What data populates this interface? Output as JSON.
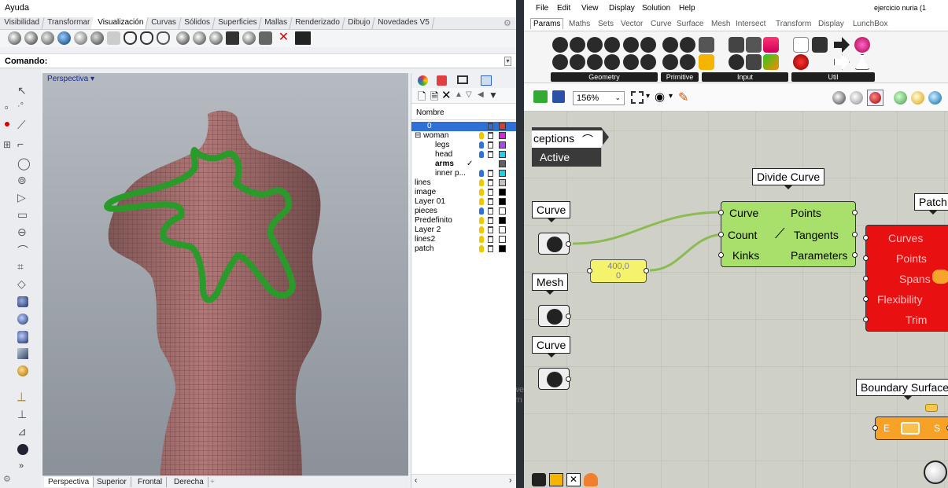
{
  "rhino": {
    "menu_title": "Ayuda",
    "tabs": [
      "Visibilidad",
      "Transformar",
      "Visualización",
      "Curvas",
      "Sólidos",
      "Superficies",
      "Mallas",
      "Renderizado",
      "Dibujo",
      "Novedades V5"
    ],
    "active_tab": "Visualización",
    "command_label": "Comando:",
    "viewport_title": "Perspectiva",
    "viewport_tabs": [
      "Perspectiva",
      "Superior",
      "Frontal",
      "Derecha"
    ],
    "layers_header": "Nombre",
    "layers": [
      {
        "name": "0",
        "color": "#d93a3a",
        "selected": true
      },
      {
        "name": "woman",
        "color": "#e020e0",
        "expander": "⊟"
      },
      {
        "name": "legs",
        "color": "#b040ff"
      },
      {
        "name": "head",
        "color": "#20d0f0"
      },
      {
        "name": "arms",
        "color": "#606060",
        "current": true
      },
      {
        "name": "inner p...",
        "color": "#10d8e8"
      },
      {
        "name": "lines",
        "color": "#c0c0c0"
      },
      {
        "name": "image",
        "color": "#000000"
      },
      {
        "name": "Layer 01",
        "color": "#000000"
      },
      {
        "name": "pieces",
        "color": "#ffffff"
      },
      {
        "name": "Predefinito",
        "color": "#000000"
      },
      {
        "name": "Layer 2",
        "color": "#ffffff"
      },
      {
        "name": "lines2",
        "color": "#ffffff"
      },
      {
        "name": "patch",
        "color": "#000000"
      }
    ],
    "checkmark": "✓"
  },
  "gh": {
    "menu": [
      "File",
      "Edit",
      "View",
      "Display",
      "Solution",
      "Help"
    ],
    "doc_title": "ejercicio nuria (1",
    "tabs": [
      "Params",
      "Maths",
      "Sets",
      "Vector",
      "Curve",
      "Surface",
      "Mesh",
      "Intersect",
      "Transform",
      "Display",
      "LunchBox"
    ],
    "active_tab": "Params",
    "groups": [
      "Geometry",
      "Primitive",
      "Input",
      "Util"
    ],
    "zoom": "156%",
    "canvas": {
      "exceptions_text": "ceptions",
      "active_text": "Active",
      "divide_curve_label": "Divide Curve",
      "divide_inputs": [
        "Curve",
        "Count",
        "Kinks"
      ],
      "divide_outputs": [
        "Points",
        "Tangents",
        "Parameters"
      ],
      "patch_label": "Patch",
      "patch_inputs": [
        "Curves",
        "Points",
        "Spans",
        "Flexibility",
        "Trim"
      ],
      "curve_label_1": "Curve",
      "mesh_label": "Mesh",
      "curve_label_2": "Curve",
      "panel_value": "400,0\n0",
      "boundary_label": "Boundary Surfaces",
      "boundary_in": "E",
      "boundary_out": "S",
      "stray_text": "we\nim"
    }
  }
}
